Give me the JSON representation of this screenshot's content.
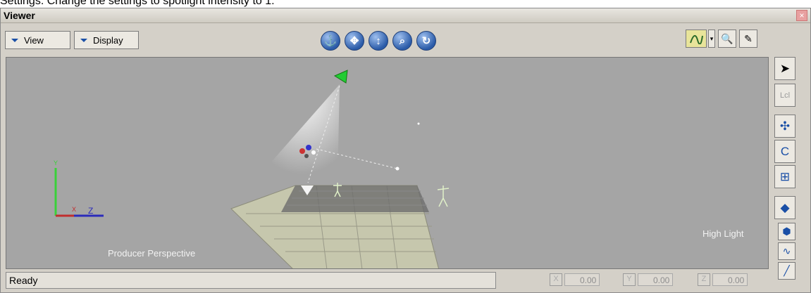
{
  "caption": "Settings. Change the settings to spotlight intensity to 1.",
  "window": {
    "title": "Viewer",
    "close_label": "×"
  },
  "toolbar": {
    "view_label": "View",
    "display_label": "Display",
    "nav_icons": [
      "anchor-icon",
      "move-icon",
      "vertical-move-icon",
      "zoom-icon",
      "orbit-icon"
    ],
    "tool_icons": [
      "curve-icon",
      "zoom-2d-icon",
      "edit-icon"
    ]
  },
  "viewport": {
    "camera_label": "Producer Perspective",
    "light_label": "High Light",
    "background_color": "#a5a5a5",
    "axis": {
      "x": "X",
      "y": "Y",
      "z": "Z"
    }
  },
  "right_tools": [
    "select-icon",
    "lcl-icon",
    "translate-icon",
    "rotate-icon",
    "scale-icon",
    "render-cube-icon",
    "solid-cube-icon",
    "wave-icon",
    "curve-tool-icon"
  ],
  "right_tools_text": {
    "lcl": "Lcl"
  },
  "statusbar": {
    "status": "Ready",
    "coords": [
      {
        "letter": "X",
        "value": "0.00"
      },
      {
        "letter": "Y",
        "value": "0.00"
      },
      {
        "letter": "Z",
        "value": "0.00"
      }
    ]
  }
}
